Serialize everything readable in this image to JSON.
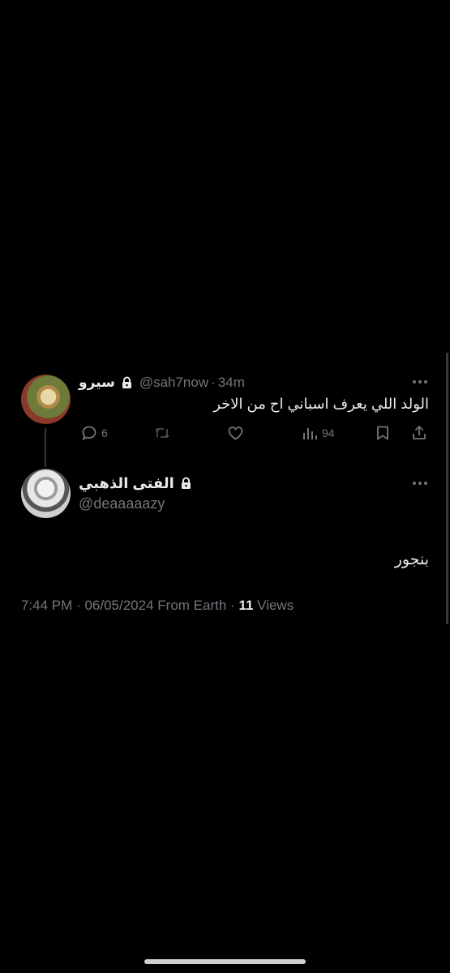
{
  "reply_to": {
    "display_name": "سيرو",
    "handle": "@sah7now",
    "separator": "·",
    "time": "34m",
    "text": "الولد اللي يعرف اسباني اح من الاخر",
    "reply_count": "6",
    "view_count": "94"
  },
  "tweet": {
    "display_name": "الفتى الذهبي",
    "handle": "@deaaaaazy",
    "text": "بنجور",
    "meta": {
      "time": "7:44 PM",
      "dot1": "·",
      "date": "06/05/2024",
      "source": "From Earth",
      "dot2": "·",
      "views_count": "11",
      "views_label": "Views"
    }
  },
  "icons": {
    "more": "more-dots-icon",
    "lock": "lock-icon",
    "reply": "reply-bubble-icon",
    "retweet": "retweet-icon",
    "like": "heart-icon",
    "views": "bar-chart-icon",
    "bookmark": "bookmark-icon",
    "share": "share-upload-icon"
  }
}
